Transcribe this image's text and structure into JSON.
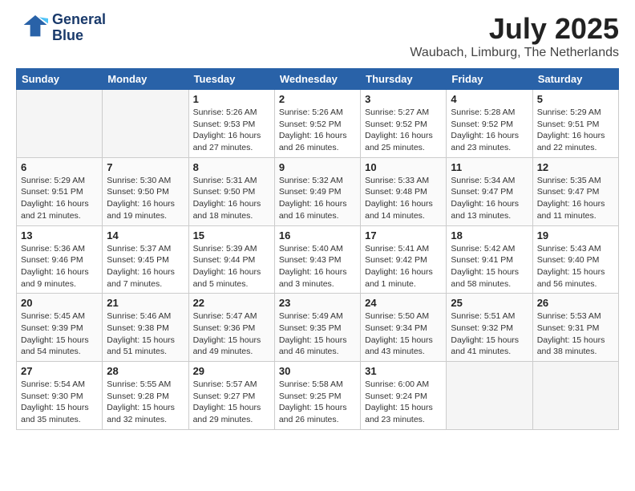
{
  "logo": {
    "line1": "General",
    "line2": "Blue"
  },
  "title": "July 2025",
  "location": "Waubach, Limburg, The Netherlands",
  "days_of_week": [
    "Sunday",
    "Monday",
    "Tuesday",
    "Wednesday",
    "Thursday",
    "Friday",
    "Saturday"
  ],
  "weeks": [
    [
      {
        "num": "",
        "empty": true
      },
      {
        "num": "",
        "empty": true
      },
      {
        "num": "1",
        "rise": "5:26 AM",
        "set": "9:53 PM",
        "daylight": "16 hours and 27 minutes."
      },
      {
        "num": "2",
        "rise": "5:26 AM",
        "set": "9:52 PM",
        "daylight": "16 hours and 26 minutes."
      },
      {
        "num": "3",
        "rise": "5:27 AM",
        "set": "9:52 PM",
        "daylight": "16 hours and 25 minutes."
      },
      {
        "num": "4",
        "rise": "5:28 AM",
        "set": "9:52 PM",
        "daylight": "16 hours and 23 minutes."
      },
      {
        "num": "5",
        "rise": "5:29 AM",
        "set": "9:51 PM",
        "daylight": "16 hours and 22 minutes."
      }
    ],
    [
      {
        "num": "6",
        "rise": "5:29 AM",
        "set": "9:51 PM",
        "daylight": "16 hours and 21 minutes."
      },
      {
        "num": "7",
        "rise": "5:30 AM",
        "set": "9:50 PM",
        "daylight": "16 hours and 19 minutes."
      },
      {
        "num": "8",
        "rise": "5:31 AM",
        "set": "9:50 PM",
        "daylight": "16 hours and 18 minutes."
      },
      {
        "num": "9",
        "rise": "5:32 AM",
        "set": "9:49 PM",
        "daylight": "16 hours and 16 minutes."
      },
      {
        "num": "10",
        "rise": "5:33 AM",
        "set": "9:48 PM",
        "daylight": "16 hours and 14 minutes."
      },
      {
        "num": "11",
        "rise": "5:34 AM",
        "set": "9:47 PM",
        "daylight": "16 hours and 13 minutes."
      },
      {
        "num": "12",
        "rise": "5:35 AM",
        "set": "9:47 PM",
        "daylight": "16 hours and 11 minutes."
      }
    ],
    [
      {
        "num": "13",
        "rise": "5:36 AM",
        "set": "9:46 PM",
        "daylight": "16 hours and 9 minutes."
      },
      {
        "num": "14",
        "rise": "5:37 AM",
        "set": "9:45 PM",
        "daylight": "16 hours and 7 minutes."
      },
      {
        "num": "15",
        "rise": "5:39 AM",
        "set": "9:44 PM",
        "daylight": "16 hours and 5 minutes."
      },
      {
        "num": "16",
        "rise": "5:40 AM",
        "set": "9:43 PM",
        "daylight": "16 hours and 3 minutes."
      },
      {
        "num": "17",
        "rise": "5:41 AM",
        "set": "9:42 PM",
        "daylight": "16 hours and 1 minute."
      },
      {
        "num": "18",
        "rise": "5:42 AM",
        "set": "9:41 PM",
        "daylight": "15 hours and 58 minutes."
      },
      {
        "num": "19",
        "rise": "5:43 AM",
        "set": "9:40 PM",
        "daylight": "15 hours and 56 minutes."
      }
    ],
    [
      {
        "num": "20",
        "rise": "5:45 AM",
        "set": "9:39 PM",
        "daylight": "15 hours and 54 minutes."
      },
      {
        "num": "21",
        "rise": "5:46 AM",
        "set": "9:38 PM",
        "daylight": "15 hours and 51 minutes."
      },
      {
        "num": "22",
        "rise": "5:47 AM",
        "set": "9:36 PM",
        "daylight": "15 hours and 49 minutes."
      },
      {
        "num": "23",
        "rise": "5:49 AM",
        "set": "9:35 PM",
        "daylight": "15 hours and 46 minutes."
      },
      {
        "num": "24",
        "rise": "5:50 AM",
        "set": "9:34 PM",
        "daylight": "15 hours and 43 minutes."
      },
      {
        "num": "25",
        "rise": "5:51 AM",
        "set": "9:32 PM",
        "daylight": "15 hours and 41 minutes."
      },
      {
        "num": "26",
        "rise": "5:53 AM",
        "set": "9:31 PM",
        "daylight": "15 hours and 38 minutes."
      }
    ],
    [
      {
        "num": "27",
        "rise": "5:54 AM",
        "set": "9:30 PM",
        "daylight": "15 hours and 35 minutes."
      },
      {
        "num": "28",
        "rise": "5:55 AM",
        "set": "9:28 PM",
        "daylight": "15 hours and 32 minutes."
      },
      {
        "num": "29",
        "rise": "5:57 AM",
        "set": "9:27 PM",
        "daylight": "15 hours and 29 minutes."
      },
      {
        "num": "30",
        "rise": "5:58 AM",
        "set": "9:25 PM",
        "daylight": "15 hours and 26 minutes."
      },
      {
        "num": "31",
        "rise": "6:00 AM",
        "set": "9:24 PM",
        "daylight": "15 hours and 23 minutes."
      },
      {
        "num": "",
        "empty": true
      },
      {
        "num": "",
        "empty": true
      }
    ]
  ]
}
